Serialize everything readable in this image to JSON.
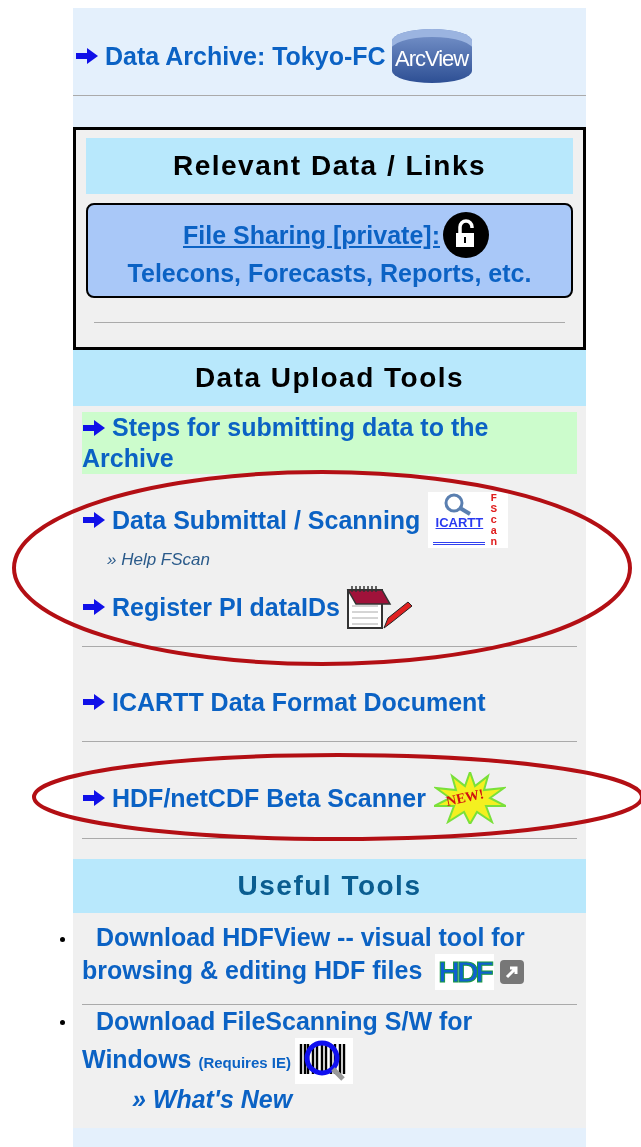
{
  "archive_link": {
    "label": "Data Archive: Tokyo-FC",
    "logo_text": "ArcView"
  },
  "relevant": {
    "title": "Relevant Data / Links",
    "link": "File Sharing [private]:",
    "subtitle": "Telecons, Forecasts, Reports, etc."
  },
  "upload": {
    "title": "Data Upload Tools",
    "items": [
      {
        "kind": "highlight",
        "label": "Steps for submitting data to the Archive"
      },
      {
        "kind": "link",
        "label": "Data Submittal / Scanning",
        "badge": {
          "kind": "scan-logo",
          "text": "ICARTT",
          "side_text": "FScan"
        },
        "sub_link": "» Help FScan"
      },
      {
        "kind": "link",
        "label": "Register PI dataIDs",
        "badge": {
          "kind": "notepad"
        }
      },
      {
        "kind": "divider"
      },
      {
        "kind": "link",
        "label": "ICARTT Data Format Document"
      },
      {
        "kind": "divider"
      },
      {
        "kind": "link",
        "label": "HDF/netCDF Beta Scanner",
        "badge": {
          "kind": "starburst",
          "text": "NEW!"
        }
      },
      {
        "kind": "divider"
      }
    ]
  },
  "useful": {
    "title": "Useful Tools",
    "items": [
      {
        "label": "Download HDFView -- visual tool for browsing & editing HDF files",
        "badge": {
          "kind": "letters-logo",
          "text": "HDF"
        },
        "external": true
      },
      {
        "label": "Download FileScanning S/W for Windows",
        "note": "(Requires IE)",
        "badge": {
          "kind": "barcode"
        },
        "sub_link": "» What's New",
        "external": false
      }
    ]
  }
}
